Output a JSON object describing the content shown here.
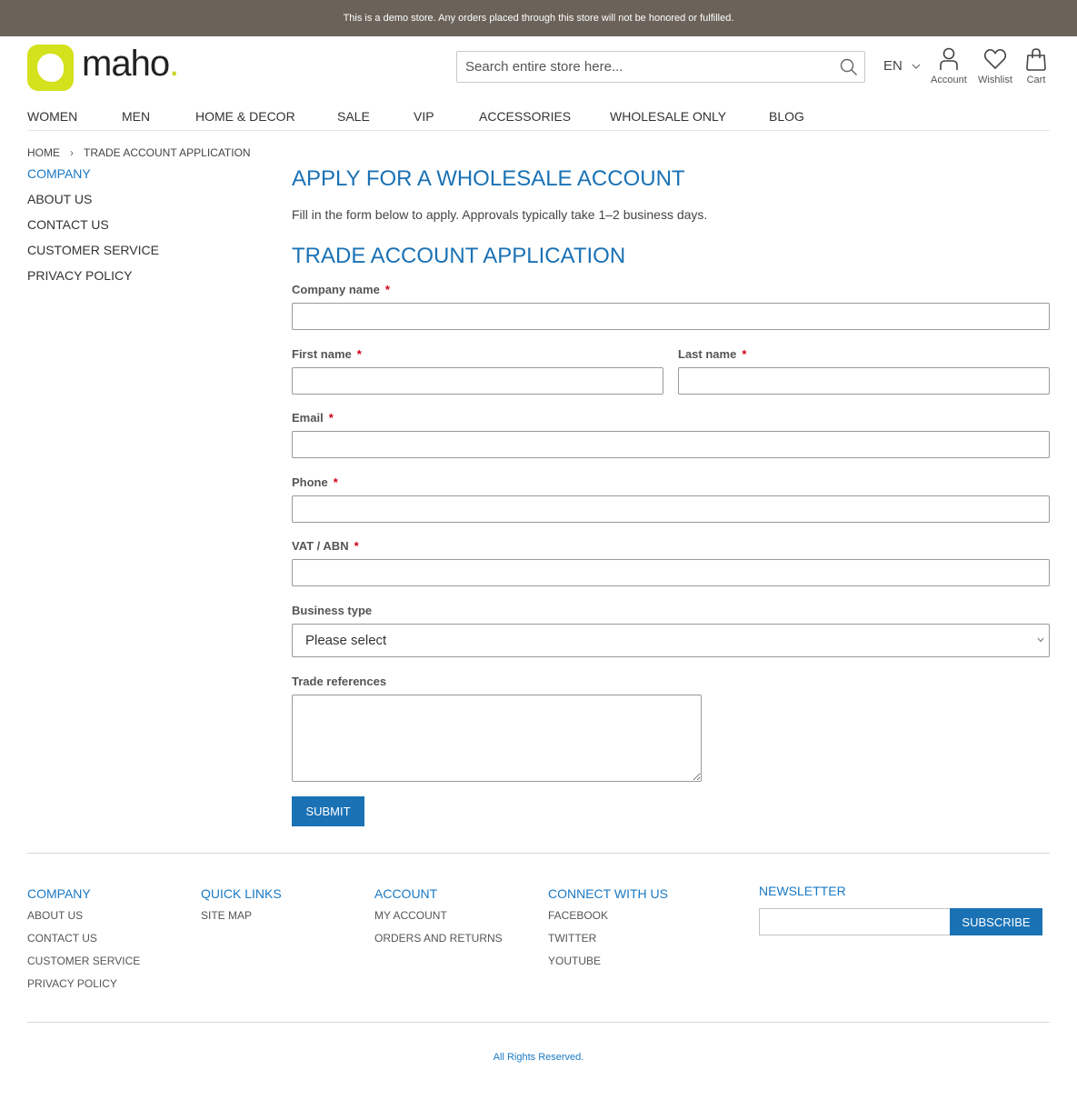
{
  "demo_notice": "This is a demo store. Any orders placed through this store will not be honored or fulfilled.",
  "logo": {
    "text": "maho",
    "dot": "."
  },
  "search": {
    "placeholder": "Search entire store here..."
  },
  "language": "EN",
  "header_links": {
    "account": "Account",
    "wishlist": "Wishlist",
    "cart": "Cart"
  },
  "nav": [
    "WOMEN",
    "MEN",
    "HOME & DECOR",
    "SALE",
    "VIP",
    "ACCESSORIES",
    "WHOLESALE ONLY",
    "BLOG"
  ],
  "breadcrumb": {
    "home": "HOME",
    "separator": "›",
    "current": "TRADE ACCOUNT APPLICATION"
  },
  "sidebar": {
    "title": "COMPANY",
    "items": [
      "ABOUT US",
      "CONTACT US",
      "CUSTOMER SERVICE",
      "PRIVACY POLICY"
    ]
  },
  "page_title": "APPLY FOR A WHOLESALE ACCOUNT",
  "intro": "Fill in the form below to apply. Approvals typically take 1–2 business days.",
  "form": {
    "title": "TRADE ACCOUNT APPLICATION",
    "required_mark": "*",
    "company_name": {
      "label": "Company name",
      "value": ""
    },
    "first_name": {
      "label": "First name",
      "value": ""
    },
    "last_name": {
      "label": "Last name",
      "value": ""
    },
    "email": {
      "label": "Email",
      "value": ""
    },
    "phone": {
      "label": "Phone",
      "value": ""
    },
    "vat": {
      "label": "VAT / ABN",
      "value": ""
    },
    "business_type": {
      "label": "Business type",
      "selected": "Please select"
    },
    "trade_references": {
      "label": "Trade references",
      "value": ""
    },
    "submit": "SUBMIT"
  },
  "footer": {
    "company": {
      "title": "COMPANY",
      "links": [
        "ABOUT US",
        "CONTACT US",
        "CUSTOMER SERVICE",
        "PRIVACY POLICY"
      ]
    },
    "quick_links": {
      "title": "QUICK LINKS",
      "links": [
        "SITE MAP"
      ]
    },
    "account": {
      "title": "ACCOUNT",
      "links": [
        "MY ACCOUNT",
        "ORDERS AND RETURNS"
      ]
    },
    "connect": {
      "title": "CONNECT WITH US",
      "links": [
        "FACEBOOK",
        "TWITTER",
        "YOUTUBE"
      ]
    },
    "newsletter": {
      "title": "NEWSLETTER",
      "button": "SUBSCRIBE",
      "value": ""
    }
  },
  "copyright": "All Rights Reserved.",
  "colors": {
    "accent": "#1a72b5",
    "link": "#1979c3",
    "logo_green": "#d4e11d",
    "notice_bg": "#6b6359",
    "required": "#d0001a"
  },
  "icons": [
    "search-icon",
    "chevron-down-icon",
    "account-icon",
    "heart-icon",
    "bag-icon"
  ]
}
